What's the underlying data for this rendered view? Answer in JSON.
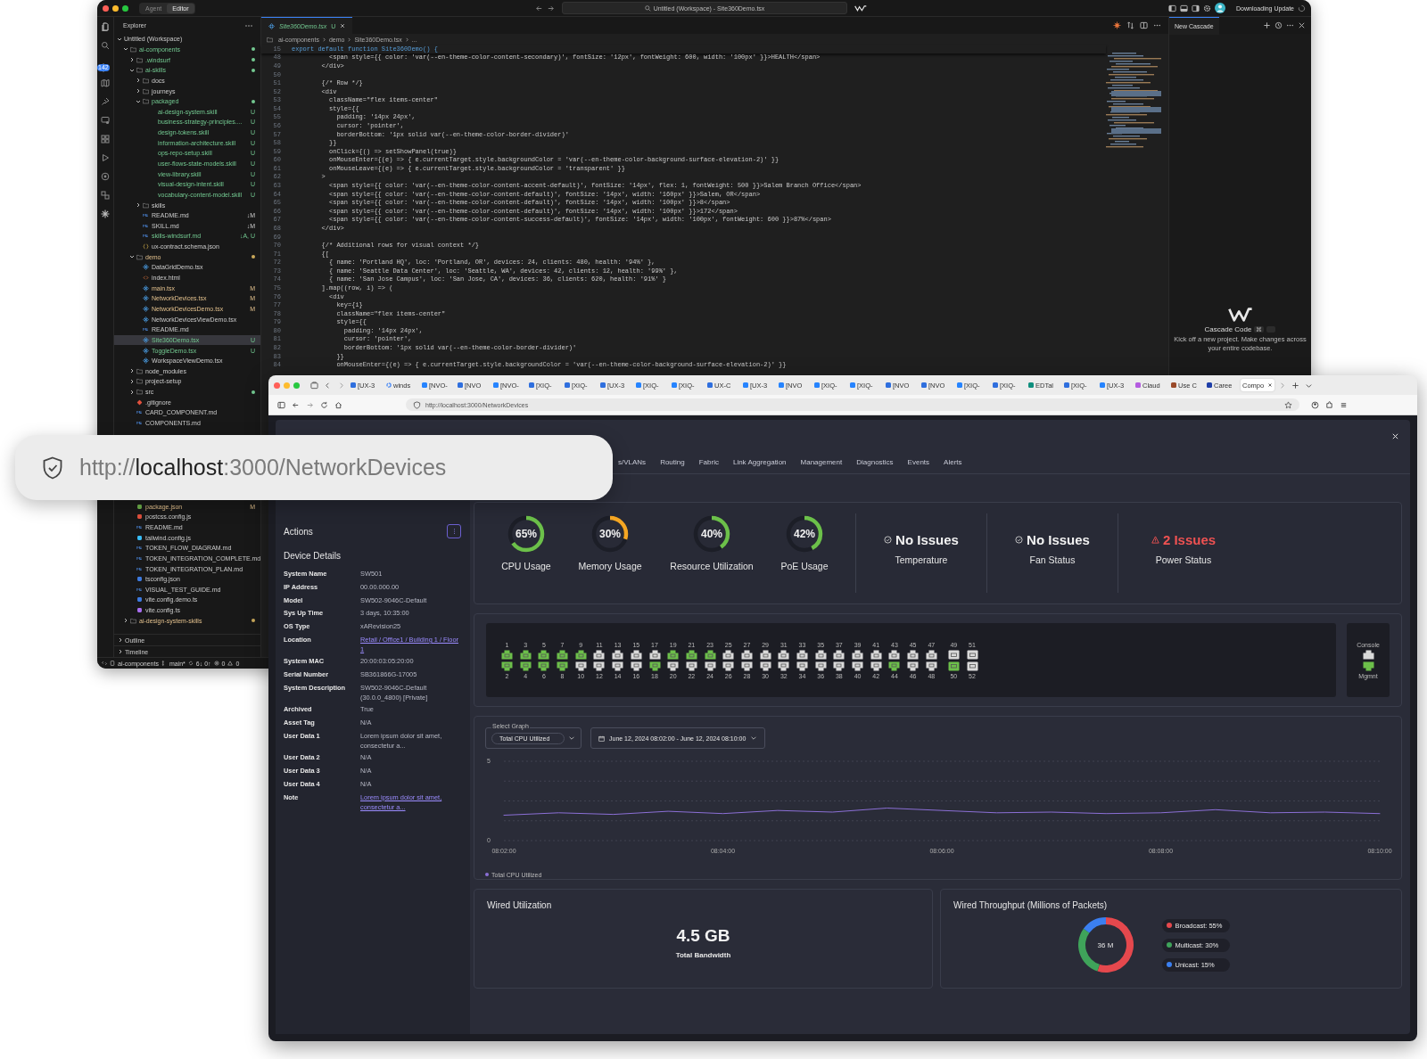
{
  "ide": {
    "mode_toggle": [
      {
        "label": "Agent",
        "selected": false
      },
      {
        "label": "Editor",
        "selected": true
      }
    ],
    "title": "Untitled (Workspace) - Site360Demo.tsx",
    "update_status": "Downloading Update",
    "scm_badge": "142",
    "explorer": {
      "title": "Explorer",
      "tree": [
        {
          "name": "Untitled (Workspace)",
          "kind": "workspace",
          "untracked": false,
          "modified": false,
          "expanded": true,
          "dot": false,
          "selected": false,
          "children": [
            {
              "name": "ai-components",
              "kind": "folder",
              "untracked": true,
              "modified": false,
              "dot": true,
              "expanded": true,
              "selected": false,
              "children": [
                {
                  "name": ".windsurf",
                  "kind": "folder",
                  "untracked": true,
                  "modified": false,
                  "dot": true,
                  "expanded": false,
                  "selected": false
                },
                {
                  "name": "ai-skills",
                  "kind": "folder",
                  "untracked": true,
                  "modified": false,
                  "dot": true,
                  "expanded": true,
                  "selected": false,
                  "children": [
                    {
                      "name": "docs",
                      "kind": "folder",
                      "untracked": false,
                      "modified": false,
                      "dot": false,
                      "expanded": false,
                      "selected": false
                    },
                    {
                      "name": "journeys",
                      "kind": "folder",
                      "untracked": false,
                      "modified": false,
                      "dot": false,
                      "expanded": false,
                      "selected": false
                    },
                    {
                      "name": "packaged",
                      "kind": "folder",
                      "untracked": true,
                      "modified": false,
                      "dot": true,
                      "expanded": true,
                      "selected": false,
                      "children": [
                        {
                          "name": "ai-design-system.skill",
                          "kind": "skill",
                          "untracked": true,
                          "modified": false,
                          "badge": "U",
                          "selected": false
                        },
                        {
                          "name": "business-strategy-principles....",
                          "kind": "skill",
                          "untracked": true,
                          "modified": false,
                          "badge": "U",
                          "selected": false
                        },
                        {
                          "name": "design-tokens.skill",
                          "kind": "skill",
                          "untracked": true,
                          "modified": false,
                          "badge": "U",
                          "selected": false
                        },
                        {
                          "name": "information-architecture.skill",
                          "kind": "skill",
                          "untracked": true,
                          "modified": false,
                          "badge": "U",
                          "selected": false
                        },
                        {
                          "name": "ops-repo-setup.skill",
                          "kind": "skill",
                          "untracked": true,
                          "modified": false,
                          "badge": "U",
                          "selected": false
                        },
                        {
                          "name": "user-flows-state-models.skill",
                          "kind": "skill",
                          "untracked": true,
                          "modified": false,
                          "badge": "U",
                          "selected": false
                        },
                        {
                          "name": "view-library.skill",
                          "kind": "skill",
                          "untracked": true,
                          "modified": false,
                          "badge": "U",
                          "selected": false
                        },
                        {
                          "name": "visual-design-intent.skill",
                          "kind": "skill",
                          "untracked": true,
                          "modified": false,
                          "badge": "U",
                          "selected": false
                        },
                        {
                          "name": "vocabulary-content-model.skill",
                          "kind": "skill",
                          "untracked": true,
                          "modified": false,
                          "badge": "U",
                          "selected": false
                        }
                      ]
                    },
                    {
                      "name": "skills",
                      "kind": "folder",
                      "untracked": false,
                      "modified": false,
                      "dot": false,
                      "expanded": false,
                      "selected": false
                    },
                    {
                      "name": "README.md",
                      "kind": "md",
                      "untracked": false,
                      "modified": false,
                      "badge": "↓M",
                      "selected": false
                    },
                    {
                      "name": "SKILL.md",
                      "kind": "md",
                      "untracked": false,
                      "modified": false,
                      "badge": "↓M",
                      "selected": false
                    },
                    {
                      "name": "skills-windsurf.md",
                      "kind": "md",
                      "untracked": true,
                      "modified": false,
                      "badge": "↓A, U",
                      "selected": false
                    },
                    {
                      "name": "ux-contract.schema.json",
                      "kind": "json",
                      "untracked": false,
                      "modified": false,
                      "selected": false
                    }
                  ]
                },
                {
                  "name": "demo",
                  "kind": "folder",
                  "untracked": false,
                  "modified": true,
                  "dot": true,
                  "expanded": true,
                  "selected": false,
                  "children": [
                    {
                      "name": "DataGridDemo.tsx",
                      "kind": "tsx",
                      "untracked": false,
                      "modified": false,
                      "selected": false
                    },
                    {
                      "name": "index.html",
                      "kind": "html",
                      "untracked": false,
                      "modified": false,
                      "selected": false
                    },
                    {
                      "name": "main.tsx",
                      "kind": "tsx",
                      "untracked": false,
                      "modified": true,
                      "badge": "M",
                      "selected": false
                    },
                    {
                      "name": "NetworkDevices.tsx",
                      "kind": "tsx",
                      "untracked": false,
                      "modified": true,
                      "badge": "M",
                      "selected": false
                    },
                    {
                      "name": "NetworkDevicesDemo.tsx",
                      "kind": "tsx",
                      "untracked": false,
                      "modified": true,
                      "badge": "M",
                      "selected": false
                    },
                    {
                      "name": "NetworkDevicesViewDemo.tsx",
                      "kind": "tsx",
                      "untracked": false,
                      "modified": false,
                      "selected": false
                    },
                    {
                      "name": "README.md",
                      "kind": "md",
                      "untracked": false,
                      "modified": false,
                      "selected": false
                    },
                    {
                      "name": "Site360Demo.tsx",
                      "kind": "tsx",
                      "untracked": true,
                      "modified": false,
                      "badge": "U",
                      "selected": true
                    },
                    {
                      "name": "ToggleDemo.tsx",
                      "kind": "tsx",
                      "untracked": true,
                      "modified": false,
                      "badge": "U",
                      "selected": false
                    },
                    {
                      "name": "WorkspaceViewDemo.tsx",
                      "kind": "tsx",
                      "untracked": false,
                      "modified": false,
                      "selected": false
                    }
                  ]
                },
                {
                  "name": "node_modules",
                  "kind": "folder",
                  "untracked": false,
                  "modified": false,
                  "dot": false,
                  "expanded": false,
                  "selected": false
                },
                {
                  "name": "project-setup",
                  "kind": "folder",
                  "untracked": false,
                  "modified": false,
                  "dot": false,
                  "expanded": false,
                  "selected": false
                },
                {
                  "name": "src",
                  "kind": "folder",
                  "untracked": false,
                  "modified": false,
                  "dot": true,
                  "expanded": false,
                  "selected": false
                },
                {
                  "name": ".gitignore",
                  "kind": "git",
                  "untracked": false,
                  "modified": false,
                  "selected": false
                },
                {
                  "name": "CARD_COMPONENT.md",
                  "kind": "md",
                  "untracked": false,
                  "modified": false,
                  "selected": false
                },
                {
                  "name": "COMPONENTS.md",
                  "kind": "md",
                  "untracked": false,
                  "modified": false,
                  "selected": false
                },
                {
                  "name": "package.json",
                  "kind": "node",
                  "untracked": false,
                  "modified": true,
                  "badge": "M",
                  "selected": false
                },
                {
                  "name": "postcss.config.js",
                  "kind": "postcss",
                  "untracked": false,
                  "modified": false,
                  "selected": false
                },
                {
                  "name": "README.md",
                  "kind": "md",
                  "untracked": false,
                  "modified": false,
                  "selected": false
                },
                {
                  "name": "tailwind.config.js",
                  "kind": "tailwind",
                  "untracked": false,
                  "modified": false,
                  "selected": false
                },
                {
                  "name": "TOKEN_FLOW_DIAGRAM.md",
                  "kind": "md",
                  "untracked": false,
                  "modified": false,
                  "selected": false
                },
                {
                  "name": "TOKEN_INTEGRATION_COMPLETE.md",
                  "kind": "md",
                  "untracked": false,
                  "modified": false,
                  "selected": false
                },
                {
                  "name": "TOKEN_INTEGRATION_PLAN.md",
                  "kind": "md",
                  "untracked": false,
                  "modified": false,
                  "selected": false
                },
                {
                  "name": "tsconfig.json",
                  "kind": "ts",
                  "untracked": false,
                  "modified": false,
                  "selected": false
                },
                {
                  "name": "VISUAL_TEST_GUIDE.md",
                  "kind": "md",
                  "untracked": false,
                  "modified": false,
                  "selected": false
                },
                {
                  "name": "vite.config.demo.ts",
                  "kind": "ts",
                  "untracked": false,
                  "modified": false,
                  "selected": false
                },
                {
                  "name": "vite.config.ts",
                  "kind": "vite",
                  "untracked": false,
                  "modified": false,
                  "selected": false
                }
              ]
            },
            {
              "name": "ai-design-system-skills",
              "kind": "folder",
              "untracked": false,
              "modified": true,
              "dot": true,
              "expanded": false,
              "selected": false
            }
          ]
        }
      ]
    },
    "sections": [
      {
        "label": "Outline",
        "expanded": false
      },
      {
        "label": "Timeline",
        "expanded": false
      }
    ],
    "editor": {
      "tab": {
        "label": "Site360Demo.tsx",
        "badge": "U"
      },
      "breadcrumb": [
        "ai-components",
        "demo",
        "Site360Demo.tsx",
        "..."
      ],
      "sticky": {
        "n": "15",
        "text": "export default function Site360Demo() {"
      },
      "lines": [
        {
          "n": "48",
          "text": "          <span style={{ color: 'var(--en-theme-color-content-secondary)', fontSize: '12px', fontWeight: 600, width: '100px' }}>HEALTH</span>"
        },
        {
          "n": "49",
          "text": "        </div>"
        },
        {
          "n": "50"
        },
        {
          "n": "51",
          "text": "        {/* Row */}"
        },
        {
          "n": "52",
          "text": "        <div"
        },
        {
          "n": "53",
          "text": "          className=\"flex items-center\""
        },
        {
          "n": "54",
          "text": "          style={{"
        },
        {
          "n": "55",
          "text": "            padding: '14px 24px',"
        },
        {
          "n": "56",
          "text": "            cursor: 'pointer',"
        },
        {
          "n": "57",
          "text": "            borderBottom: '1px solid var(--en-theme-color-border-divider)'"
        },
        {
          "n": "58",
          "text": "          }}"
        },
        {
          "n": "59",
          "text": "          onClick={() => setShowPanel(true)}"
        },
        {
          "n": "60",
          "text": "          onMouseEnter={(e) => { e.currentTarget.style.backgroundColor = 'var(--en-theme-color-background-surface-elevation-2)' }}"
        },
        {
          "n": "61",
          "text": "          onMouseLeave={(e) => { e.currentTarget.style.backgroundColor = 'transparent' }}"
        },
        {
          "n": "62",
          "text": "        >"
        },
        {
          "n": "63",
          "text": "          <span style={{ color: 'var(--en-theme-color-content-accent-default)', fontSize: '14px', flex: 1, fontWeight: 500 }}>Salem Branch Office</span>"
        },
        {
          "n": "64",
          "text": "          <span style={{ color: 'var(--en-theme-color-content-default)', fontSize: '14px', width: '160px' }}>Salem, OR</span>"
        },
        {
          "n": "65",
          "text": "          <span style={{ color: 'var(--en-theme-color-content-default)', fontSize: '14px', width: '100px' }}>8</span>"
        },
        {
          "n": "66",
          "text": "          <span style={{ color: 'var(--en-theme-color-content-default)', fontSize: '14px', width: '100px' }}>172</span>"
        },
        {
          "n": "67",
          "text": "          <span style={{ color: 'var(--en-theme-color-content-success-default)', fontSize: '14px', width: '100px', fontWeight: 600 }}>87%</span>"
        },
        {
          "n": "68",
          "text": "        </div>"
        },
        {
          "n": "69"
        },
        {
          "n": "70",
          "text": "        {/* Additional rows for visual context */}"
        },
        {
          "n": "71",
          "text": "        {["
        },
        {
          "n": "72",
          "text": "          { name: 'Portland HQ', loc: 'Portland, OR', devices: 24, clients: 480, health: '94%' },"
        },
        {
          "n": "73",
          "text": "          { name: 'Seattle Data Center', loc: 'Seattle, WA', devices: 42, clients: 12, health: '99%' },"
        },
        {
          "n": "74",
          "text": "          { name: 'San Jose Campus', loc: 'San Jose, CA', devices: 36, clients: 620, health: '91%' }"
        },
        {
          "n": "75",
          "text": "        ].map((row, i) => ("
        },
        {
          "n": "76",
          "text": "          <div"
        },
        {
          "n": "77",
          "text": "            key={i}"
        },
        {
          "n": "78",
          "text": "            className=\"flex items-center\""
        },
        {
          "n": "79",
          "text": "            style={{"
        },
        {
          "n": "80",
          "text": "              padding: '14px 24px',"
        },
        {
          "n": "81",
          "text": "              cursor: 'pointer',"
        },
        {
          "n": "82",
          "text": "              borderBottom: '1px solid var(--en-theme-color-border-divider)'"
        },
        {
          "n": "83",
          "text": "            }}"
        },
        {
          "n": "84",
          "text": "            onMouseEnter={(e) => { e.currentTarget.style.backgroundColor = 'var(--en-theme-color-background-surface-elevation-2)' }}"
        }
      ]
    },
    "cascade": {
      "tab": "New Cascade",
      "title": "Cascade Code",
      "shortcut": "⌘",
      "description": "Kick off a new project. Make changes across your entire codebase."
    },
    "status_bar": {
      "folder": "ai-components",
      "branch": "main*",
      "sync": "6↓ 0↑",
      "errors": "0",
      "warnings": "0"
    }
  },
  "browser": {
    "tabs": [
      {
        "label": "[UX-3",
        "kind": "square",
        "selected": false
      },
      {
        "label": "winds",
        "kind": "ring",
        "selected": false
      },
      {
        "label": "[NVO-",
        "kind": "diamond",
        "selected": false
      },
      {
        "label": "[NVO",
        "kind": "square",
        "selected": false
      },
      {
        "label": "[NVO-",
        "kind": "diamond",
        "selected": false
      },
      {
        "label": "[XIQ-",
        "kind": "square",
        "selected": false
      },
      {
        "label": "[XIQ-",
        "kind": "square",
        "selected": false
      },
      {
        "label": "[UX-3",
        "kind": "square",
        "selected": false
      },
      {
        "label": "[XIQ-",
        "kind": "diamond",
        "selected": false
      },
      {
        "label": "[XIQ-",
        "kind": "diamond",
        "selected": false
      },
      {
        "label": "UX-C",
        "kind": "square",
        "selected": false
      },
      {
        "label": "[UX-3",
        "kind": "diamond",
        "selected": false
      },
      {
        "label": "[NVO",
        "kind": "diamond",
        "selected": false
      },
      {
        "label": "[XIQ-",
        "kind": "diamond",
        "selected": false
      },
      {
        "label": "[XIQ-",
        "kind": "diamond",
        "selected": false
      },
      {
        "label": "[NVO",
        "kind": "square",
        "selected": false
      },
      {
        "label": "[NVO",
        "kind": "square",
        "selected": false
      },
      {
        "label": "[XIQ-",
        "kind": "diamond",
        "selected": false
      },
      {
        "label": "[XIQ-",
        "kind": "square",
        "selected": false
      },
      {
        "label": "EDTal",
        "kind": "teal",
        "selected": false
      },
      {
        "label": "[XIQ-",
        "kind": "square",
        "selected": false
      },
      {
        "label": "[UX-3",
        "kind": "diamond",
        "selected": false
      },
      {
        "label": "Claud",
        "kind": "purple",
        "selected": false
      },
      {
        "label": "Use C",
        "kind": "brown",
        "selected": false
      },
      {
        "label": "Caree",
        "kind": "navy",
        "selected": false
      },
      {
        "label": "Compo",
        "kind": "blank",
        "selected": true
      }
    ],
    "url": "http://localhost:3000/NetworkDevices",
    "page": {
      "nav_tabs": [
        {
          "label": "s/VLANs",
          "selected": false
        },
        {
          "label": "Routing",
          "selected": false
        },
        {
          "label": "Fabric",
          "selected": false
        },
        {
          "label": "Link Aggregation",
          "selected": false
        },
        {
          "label": "Management",
          "selected": false
        },
        {
          "label": "Diagnostics",
          "selected": false
        },
        {
          "label": "Events",
          "selected": false
        },
        {
          "label": "Alerts",
          "selected": false
        }
      ],
      "actions_label": "Actions",
      "details_title": "Device Details",
      "details": [
        {
          "label": "System Name",
          "value": "SW501",
          "kind": "text"
        },
        {
          "label": "IP Address",
          "value": "00.00.000.00",
          "kind": "text"
        },
        {
          "label": "Model",
          "value": "SW502-9046C-Default",
          "kind": "text"
        },
        {
          "label": "Sys Up Time",
          "value": "3 days, 10:35:00",
          "kind": "text"
        },
        {
          "label": "OS Type",
          "value": "xARevision25",
          "kind": "text"
        },
        {
          "label": "Location",
          "value": "Retail / Office1 / Building 1 / Floor 1",
          "kind": "link"
        },
        {
          "label": "System MAC",
          "value": "20:00:03:05:20:00",
          "kind": "text"
        },
        {
          "label": "Serial Number",
          "value": "SB361866G-17005",
          "kind": "text"
        },
        {
          "label": "System Description",
          "value": "SW502-9046C-Default (30.0.0_4800) [Private]",
          "kind": "text"
        },
        {
          "label": "Archived",
          "value": "True",
          "kind": "text"
        },
        {
          "label": "Asset Tag",
          "value": "N/A",
          "kind": "text"
        },
        {
          "label": "User Data 1",
          "value": "Lorem ipsum dolor sit amet, consectetur a...",
          "kind": "text"
        },
        {
          "label": "User Data 2",
          "value": "N/A",
          "kind": "text"
        },
        {
          "label": "User Data 3",
          "value": "N/A",
          "kind": "text"
        },
        {
          "label": "User Data 4",
          "value": "N/A",
          "kind": "text"
        },
        {
          "label": "Note",
          "value": "Lorem ipsum dolor sit amet, consectetur a...",
          "kind": "link"
        }
      ],
      "gauges": [
        {
          "value": "65%",
          "label": "CPU Usage",
          "level": 0.65,
          "color": "#6cc04a"
        },
        {
          "value": "30%",
          "label": "Memory Usage",
          "level": 0.3,
          "color": "#f5a623"
        },
        {
          "value": "40%",
          "label": "Resource Utilization",
          "level": 0.4,
          "color": "#6cc04a"
        },
        {
          "value": "42%",
          "label": "PoE Usage",
          "level": 0.42,
          "color": "#6cc04a"
        }
      ],
      "statuses": [
        {
          "title": "No Issues",
          "label": "Temperature",
          "kind": "ok"
        },
        {
          "title": "No Issues",
          "label": "Fan Status",
          "kind": "ok"
        },
        {
          "title": "2 Issues",
          "label": "Power Status",
          "kind": "warning"
        }
      ],
      "ports": {
        "pairs": [
          {
            "top": {
              "label": "1",
              "up": true
            },
            "bottom": {
              "label": "2",
              "up": true
            }
          },
          {
            "top": {
              "label": "3",
              "up": true
            },
            "bottom": {
              "label": "4",
              "up": true
            }
          },
          {
            "top": {
              "label": "5",
              "up": true
            },
            "bottom": {
              "label": "6",
              "up": true
            }
          },
          {
            "top": {
              "label": "7",
              "up": true
            },
            "bottom": {
              "label": "8",
              "up": true
            }
          },
          {
            "top": {
              "label": "9",
              "up": true
            },
            "bottom": {
              "label": "10",
              "up": false
            }
          },
          {
            "top": {
              "label": "11",
              "up": false
            },
            "bottom": {
              "label": "12",
              "up": false
            }
          },
          {
            "top": {
              "label": "13",
              "up": false
            },
            "bottom": {
              "label": "14",
              "up": false
            }
          },
          {
            "top": {
              "label": "15",
              "up": false
            },
            "bottom": {
              "label": "16",
              "up": false
            }
          },
          {
            "top": {
              "label": "17",
              "up": false
            },
            "bottom": {
              "label": "18",
              "up": true
            }
          },
          {
            "top": {
              "label": "19",
              "up": true
            },
            "bottom": {
              "label": "20",
              "up": false
            }
          },
          {
            "top": {
              "label": "21",
              "up": true
            },
            "bottom": {
              "label": "22",
              "up": false
            }
          },
          {
            "top": {
              "label": "23",
              "up": true
            },
            "bottom": {
              "label": "24",
              "up": false
            }
          },
          {
            "top": {
              "label": "25",
              "up": false
            },
            "bottom": {
              "label": "26",
              "up": false
            }
          },
          {
            "top": {
              "label": "27",
              "up": false
            },
            "bottom": {
              "label": "28",
              "up": false
            }
          },
          {
            "top": {
              "label": "29",
              "up": false
            },
            "bottom": {
              "label": "30",
              "up": false
            }
          },
          {
            "top": {
              "label": "31",
              "up": false
            },
            "bottom": {
              "label": "32",
              "up": false
            }
          },
          {
            "top": {
              "label": "33",
              "up": false
            },
            "bottom": {
              "label": "34",
              "up": false
            }
          },
          {
            "top": {
              "label": "35",
              "up": false
            },
            "bottom": {
              "label": "36",
              "up": false
            }
          },
          {
            "top": {
              "label": "37",
              "up": false
            },
            "bottom": {
              "label": "38",
              "up": false
            }
          },
          {
            "top": {
              "label": "39",
              "up": false
            },
            "bottom": {
              "label": "40",
              "up": false
            }
          },
          {
            "top": {
              "label": "41",
              "up": false
            },
            "bottom": {
              "label": "42",
              "up": false
            }
          },
          {
            "top": {
              "label": "43",
              "up": false
            },
            "bottom": {
              "label": "44",
              "up": true
            }
          },
          {
            "top": {
              "label": "45",
              "up": false
            },
            "bottom": {
              "label": "46",
              "up": false
            }
          },
          {
            "top": {
              "label": "47",
              "up": false
            },
            "bottom": {
              "label": "48",
              "up": false
            }
          }
        ],
        "uplinks": [
          {
            "top": {
              "label": "49",
              "up": false
            },
            "bottom": {
              "label": "50",
              "up": true
            }
          },
          {
            "top": {
              "label": "51",
              "up": false
            },
            "bottom": {
              "label": "52",
              "up": false
            }
          }
        ],
        "console": {
          "label": "Console",
          "up": false
        },
        "mgmt": {
          "label": "Mgmnt",
          "up": true
        }
      },
      "graph": {
        "select_label": "Select Graph",
        "select_value": "Total CPU Utilized",
        "date_range": "June 12, 2024 08:02:00 - June 12, 2024 08:10:00",
        "chart_data": {
          "type": "line",
          "categories": [
            "08:02:00",
            null,
            null,
            null,
            "08:04:00",
            null,
            null,
            null,
            "08:06:00",
            null,
            null,
            null,
            "08:08:00",
            null,
            null,
            null,
            "08:10:00"
          ],
          "series": [
            {
              "name": "Total CPU Utilized",
              "color": "#8b6fd6",
              "values": [
                1.6,
                1.75,
                1.65,
                1.85,
                1.7,
                1.9,
                1.8,
                2.05,
                1.9,
                1.75,
                1.8,
                1.7,
                1.75,
                1.95,
                1.75,
                1.8,
                1.7
              ]
            }
          ],
          "ylim": [
            0,
            5
          ],
          "yticks": [
            0,
            5
          ]
        }
      },
      "utilization": {
        "title": "Wired Utilization",
        "value": "4.5 GB",
        "caption": "Total Bandwidth"
      },
      "throughput": {
        "title": "Wired Throughput (Millions of Packets)",
        "center": "36 M",
        "chart_data": {
          "type": "donut",
          "series": [
            {
              "values": [
                55,
                30,
                15
              ]
            }
          ]
        },
        "legend": [
          {
            "label": "Broadcast: 55%",
            "color": "#e5484d"
          },
          {
            "label": "Multicast: 30%",
            "color": "#3fa35a"
          },
          {
            "label": "Unicast: 15%",
            "color": "#3b7ff0"
          }
        ]
      }
    }
  },
  "callout": {
    "url_parts": [
      {
        "text": "http://",
        "kind": "dim"
      },
      {
        "text": "localhost",
        "kind": "host"
      },
      {
        "text": ":3000/NetworkDevices",
        "kind": "dim"
      }
    ]
  }
}
